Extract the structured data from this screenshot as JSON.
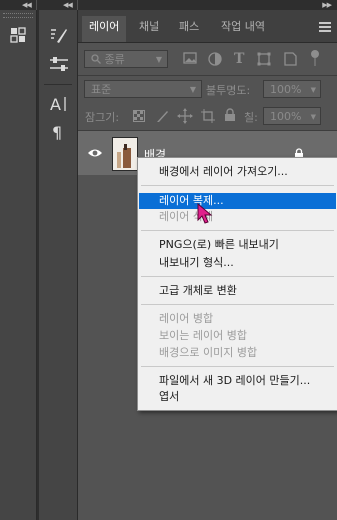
{
  "layers_panel": {
    "tabs": [
      {
        "label": "레이어"
      },
      {
        "label": "채널"
      },
      {
        "label": "패스"
      },
      {
        "label": "작업 내역"
      }
    ],
    "filter": {
      "kind_value": "종류"
    },
    "blend_mode": {
      "value": "표준"
    },
    "opacity": {
      "label": "불투명도:",
      "value": "100%"
    },
    "lock": {
      "label": "잠그기:"
    },
    "fill": {
      "label": "칠:",
      "value": "100%"
    },
    "layers": [
      {
        "name": "배경",
        "visible": true,
        "locked": true
      }
    ]
  },
  "context_menu": {
    "items": [
      {
        "label": "배경에서 레이어 가져오기...",
        "enabled": true
      },
      {
        "label": "레이어 복제...",
        "enabled": true,
        "highlighted": true
      },
      {
        "label": "레이어 삭제",
        "enabled": false
      },
      {
        "label": "PNG으(로) 빠른 내보내기",
        "enabled": true
      },
      {
        "label": "내보내기 형식...",
        "enabled": true
      },
      {
        "label": "고급 개체로 변환",
        "enabled": true
      },
      {
        "label": "레이어 병합",
        "enabled": false
      },
      {
        "label": "보이는 레이어 병합",
        "enabled": false
      },
      {
        "label": "배경으로 이미지 병합",
        "enabled": false
      },
      {
        "label": "파일에서 새 3D 레이어 만들기...",
        "enabled": true
      },
      {
        "label": "엽서",
        "enabled": true
      }
    ]
  },
  "colors": {
    "panel_bg": "#535353",
    "dark_bar": "#2e2e2e",
    "menu_bg": "#f0f0f0",
    "menu_highlight": "#0a6fd6",
    "cursor": "#e0208c"
  }
}
